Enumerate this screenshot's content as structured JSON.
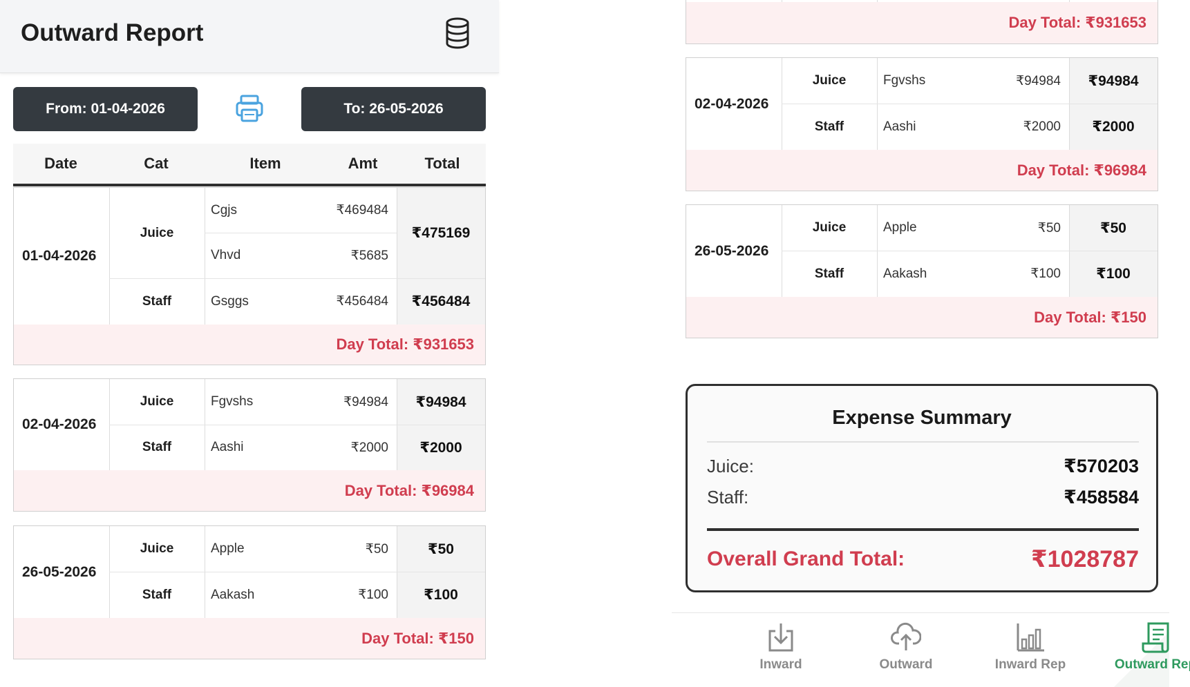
{
  "header": {
    "title": "Outward Report",
    "icon": "database-icon"
  },
  "filters": {
    "from_label": "From: 01-04-2026",
    "to_label": "To: 26-05-2026",
    "print_icon": "printer-icon"
  },
  "table": {
    "columns": [
      "Date",
      "Cat",
      "Item",
      "Amt",
      "Total"
    ]
  },
  "days": [
    {
      "date": "01-04-2026",
      "groups": [
        {
          "cat": "Juice",
          "items": [
            {
              "item": "Cgjs",
              "amt": "₹469484"
            },
            {
              "item": "Vhvd",
              "amt": "₹5685"
            }
          ],
          "total": "₹475169"
        },
        {
          "cat": "Staff",
          "items": [
            {
              "item": "Gsggs",
              "amt": "₹456484"
            }
          ],
          "total": "₹456484"
        }
      ],
      "day_total": "Day Total: ₹931653"
    },
    {
      "date": "02-04-2026",
      "groups": [
        {
          "cat": "Juice",
          "items": [
            {
              "item": "Fgvshs",
              "amt": "₹94984"
            }
          ],
          "total": "₹94984"
        },
        {
          "cat": "Staff",
          "items": [
            {
              "item": "Aashi",
              "amt": "₹2000"
            }
          ],
          "total": "₹2000"
        }
      ],
      "day_total": "Day Total: ₹96984"
    },
    {
      "date": "26-05-2026",
      "groups": [
        {
          "cat": "Juice",
          "items": [
            {
              "item": "Apple",
              "amt": "₹50"
            }
          ],
          "total": "₹50"
        },
        {
          "cat": "Staff",
          "items": [
            {
              "item": "Aakash",
              "amt": "₹100"
            }
          ],
          "total": "₹100"
        }
      ],
      "day_total": "Day Total: ₹150"
    }
  ],
  "summary": {
    "title": "Expense Summary",
    "rows": [
      {
        "label": "Juice:",
        "value": "₹570203"
      },
      {
        "label": "Staff:",
        "value": "₹458584"
      }
    ],
    "grand_label": "Overall Grand Total:",
    "grand_value": "₹1028787"
  },
  "nav": [
    {
      "label": "Inward",
      "icon": "download-tray-icon",
      "active": false
    },
    {
      "label": "Outward",
      "icon": "cloud-upload-icon",
      "active": false
    },
    {
      "label": "Inward Rep",
      "icon": "bar-chart-icon",
      "active": false
    },
    {
      "label": "Outward Rep",
      "icon": "receipt-report-icon",
      "active": true
    }
  ],
  "colors": {
    "accent_red": "#d03d4f",
    "active_green": "#2e9a5e",
    "dark_button": "#343a40"
  }
}
